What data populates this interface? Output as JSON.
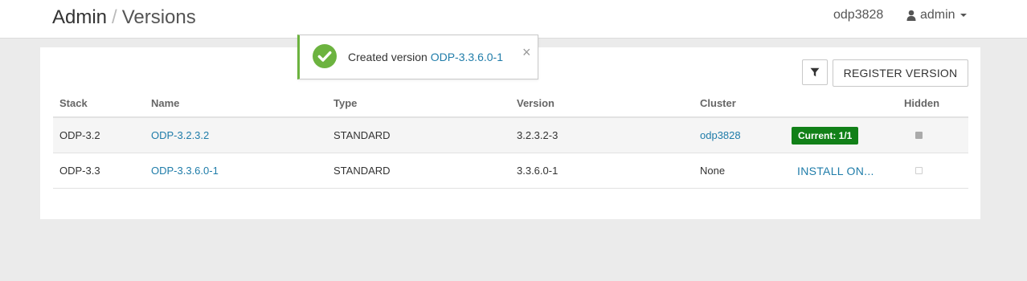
{
  "header": {
    "breadcrumb_root": "Admin",
    "breadcrumb_separator": "/",
    "breadcrumb_current": "Versions",
    "cluster_name": "odp3828",
    "user_name": "admin"
  },
  "toolbar": {
    "filter_icon": "filter-icon",
    "register_label": "REGISTER VERSION"
  },
  "table": {
    "columns": {
      "stack": "Stack",
      "name": "Name",
      "type": "Type",
      "version": "Version",
      "cluster": "Cluster",
      "hidden": "Hidden"
    },
    "rows": [
      {
        "stack": "ODP-3.2",
        "name": "ODP-3.2.3.2",
        "type": "STANDARD",
        "version": "3.2.3.2-3",
        "cluster": "odp3828",
        "status": "Current: 1/1",
        "hidden": true
      },
      {
        "stack": "ODP-3.3",
        "name": "ODP-3.3.6.0-1",
        "type": "STANDARD",
        "version": "3.3.6.0-1",
        "cluster": "None",
        "action": "INSTALL ON...",
        "hidden": false
      }
    ]
  },
  "toast": {
    "message_prefix": "Created version",
    "version_link": "ODP-3.3.6.0-1",
    "close": "×",
    "icon": "check-circle-icon",
    "color": "#6cb33f"
  },
  "colors": {
    "link": "#1f7ca9",
    "current_badge": "#118018",
    "background": "#ebebeb"
  }
}
